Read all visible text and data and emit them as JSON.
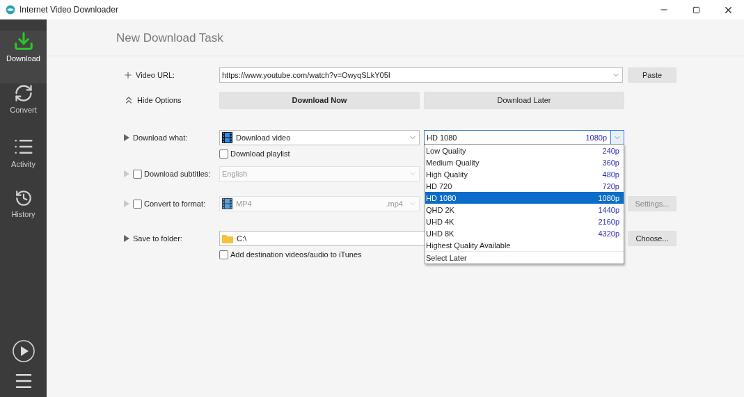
{
  "window": {
    "title": "Internet Video Downloader"
  },
  "sidebar": {
    "items": [
      {
        "kind": "download",
        "label": "Download",
        "selected": true
      },
      {
        "kind": "convert",
        "label": "Convert",
        "selected": false
      },
      {
        "kind": "activity",
        "label": "Activity",
        "selected": false
      },
      {
        "kind": "history",
        "label": "History",
        "selected": false
      }
    ]
  },
  "page": {
    "title": "New Download Task"
  },
  "url": {
    "label": "Video URL:",
    "value": "https://www.youtube.com/watch?v=OwyqSLkY05I",
    "button": "Paste"
  },
  "options_toggle": {
    "label": "Hide Options",
    "expanded": true
  },
  "actions": [
    {
      "label": "Download Now",
      "primary": true
    },
    {
      "label": "Download Later",
      "primary": false
    }
  ],
  "download_what": {
    "label": "Download what:",
    "value": "Download video",
    "playlist": {
      "label": "Download playlist",
      "checked": false
    },
    "quality": {
      "value": "HD 1080",
      "resolution": "1080p",
      "open": true,
      "options": [
        {
          "label": "Low Quality",
          "resolution": "240p",
          "selected": false
        },
        {
          "label": "Medium Quality",
          "resolution": "360p",
          "selected": false
        },
        {
          "label": "High Quality",
          "resolution": "480p",
          "selected": false
        },
        {
          "label": "HD 720",
          "resolution": "720p",
          "selected": false
        },
        {
          "label": "HD 1080",
          "resolution": "1080p",
          "selected": true
        },
        {
          "label": "QHD 2K",
          "resolution": "1440p",
          "selected": false
        },
        {
          "label": "UHD 4K",
          "resolution": "2160p",
          "selected": false
        },
        {
          "label": "UHD 8K",
          "resolution": "4320p",
          "selected": false
        },
        {
          "label": "Highest Quality Available",
          "selected": false
        },
        {
          "label": "Select Later",
          "selected": false
        }
      ]
    }
  },
  "subtitles": {
    "label": "Download subtitles:",
    "checked": false,
    "value": "English"
  },
  "convert": {
    "label": "Convert to format:",
    "checked": false,
    "value": "MP4",
    "extension": ".mp4",
    "button": "Settings..."
  },
  "save": {
    "label": "Save to folder:",
    "value": "C:\\",
    "button": "Choose...",
    "itunes": {
      "label": "Add destination videos/audio to iTunes",
      "checked": false
    }
  }
}
